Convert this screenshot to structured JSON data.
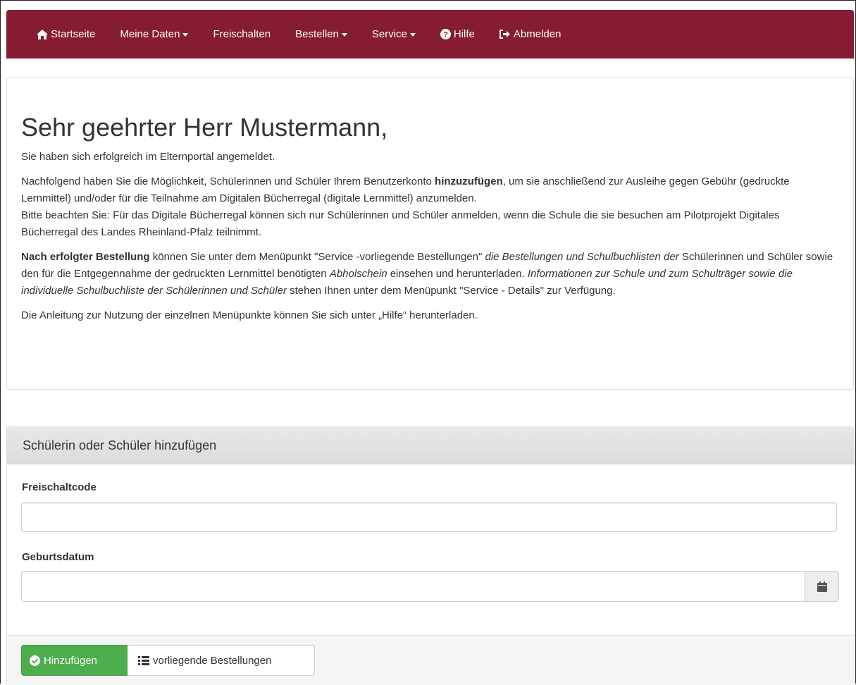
{
  "navbar": {
    "items": [
      {
        "label": "Startseite",
        "icon": "home-icon"
      },
      {
        "label": "Meine Daten",
        "dropdown": true
      },
      {
        "label": "Freischalten"
      },
      {
        "label": "Bestellen",
        "dropdown": true
      },
      {
        "label": "Service",
        "dropdown": true
      },
      {
        "label": "Hilfe",
        "icon": "question-circle-icon"
      },
      {
        "label": "Abmelden",
        "icon": "sign-out-icon"
      }
    ],
    "background": "#861c31"
  },
  "welcome": {
    "greeting": "Sehr geehrter Herr Mustermann,",
    "intro": "Sie haben sich erfolgreich im Elternportal angemeldet.",
    "p2_before": "Nachfolgend haben Sie die Möglichkeit, Schülerinnen und Schüler Ihrem Benutzerkonto ",
    "p2_bold": "hinzuzufügen",
    "p2_after": ", um sie anschließend zur Ausleihe gegen Gebühr (gedruckte Lernmittel) und/oder für die Teilnahme am Digitalen Bücherregal (digitale Lernmittel) anzumelden.",
    "p2_line2": "Bitte beachten Sie: Für das Digitale Bücherregal können sich nur Schülerinnen und Schüler anmelden, wenn die Schule die sie besuchen am Pilotprojekt Digitales Bücherregal des Landes Rheinland-Pfalz teilnimmt.",
    "p3_bold": "Nach erfolgter Bestellung",
    "p3_t1": " können Sie unter dem Menüpunkt \"Service -vorliegende Bestellungen\" ",
    "p3_i1": "die Bestellungen und Schulbuchlisten der",
    "p3_t2": " Schülerinnen und Schüler sowie den für die Entgegennahme der gedruckten Lernmittel benötigten ",
    "p3_i2": "Abholschein",
    "p3_t3": " einsehen und herunterladen. ",
    "p3_i3": "Informationen zur Schule und zum Schulträger sowie die individuelle Schulbuchliste der Schülerinnen und Schüler",
    "p3_t4": " stehen Ihnen unter dem Menüpunkt \"Service - Details\" zur Verfügung.",
    "p4": "Die Anleitung zur Nutzung der einzelnen Menüpunkte können Sie sich unter „Hilfe“ herunterladen."
  },
  "form": {
    "heading": "Schülerin oder Schüler hinzufügen",
    "code_label": "Freischaltcode",
    "code_value": "",
    "birthdate_label": "Geburtsdatum",
    "birthdate_value": "",
    "calendar_icon": "calendar-icon",
    "add_button": "Hinzufügen",
    "orders_button": "vorliegende Bestellungen",
    "success_color": "#4cae4c"
  }
}
